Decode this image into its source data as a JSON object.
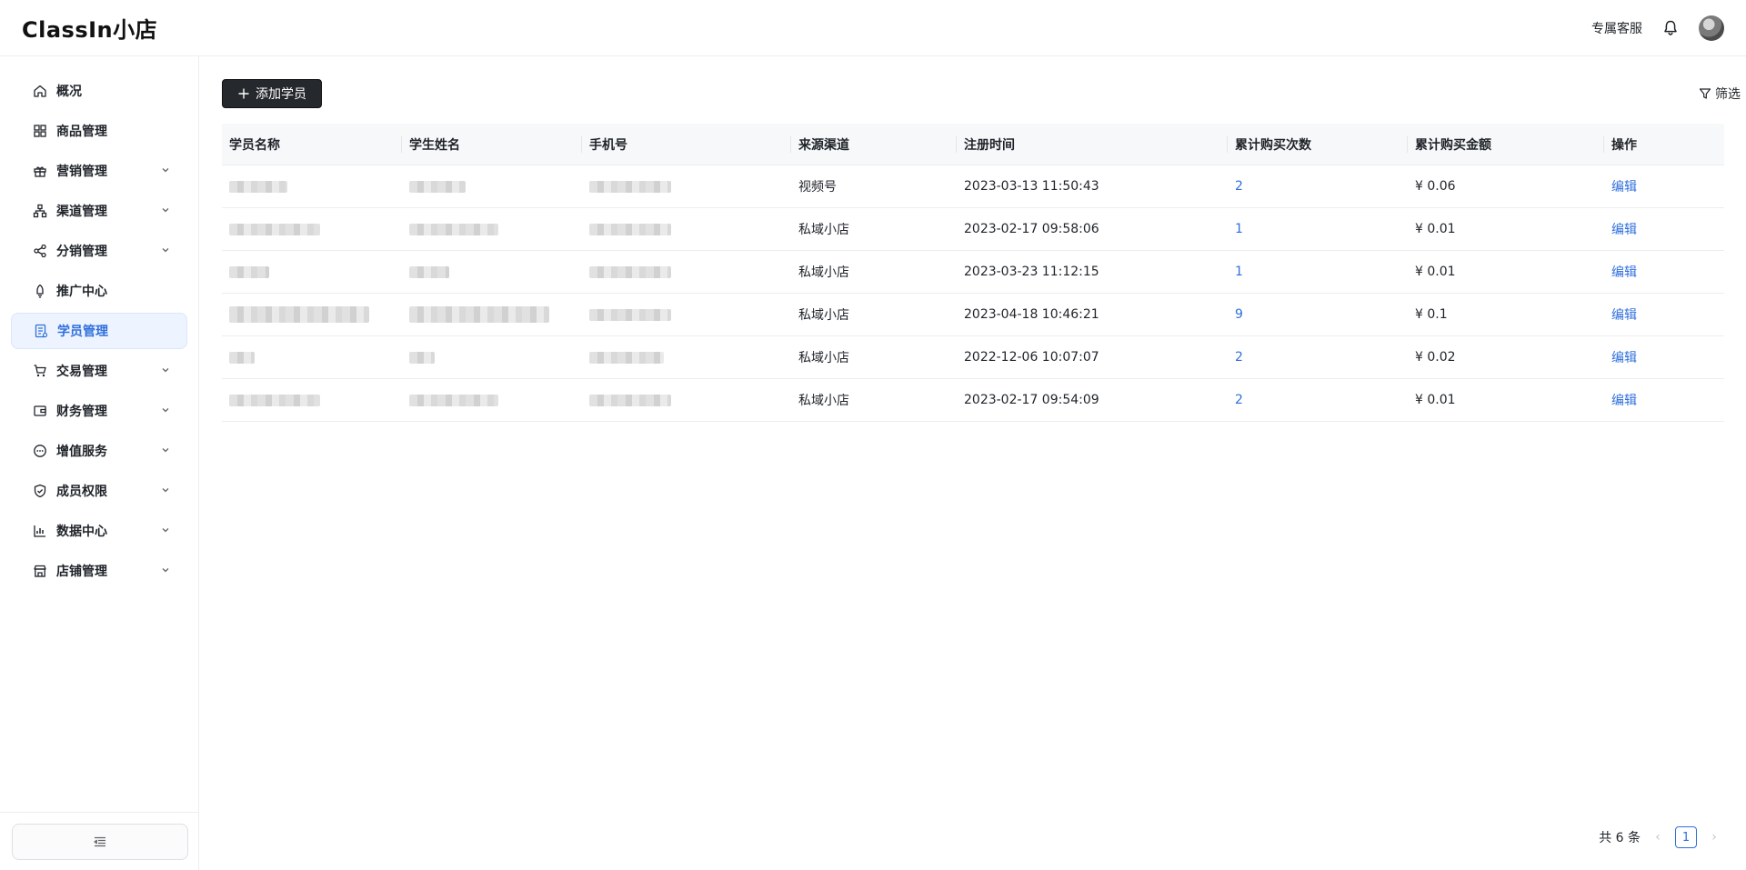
{
  "header": {
    "logo": "ClassIn小店",
    "service_link": "专属客服"
  },
  "sidebar": {
    "items": [
      {
        "label": "概况",
        "icon": "home-icon",
        "expandable": false
      },
      {
        "label": "商品管理",
        "icon": "grid-icon",
        "expandable": false
      },
      {
        "label": "营销管理",
        "icon": "gift-icon",
        "expandable": true
      },
      {
        "label": "渠道管理",
        "icon": "hierarchy-icon",
        "expandable": true
      },
      {
        "label": "分销管理",
        "icon": "share-icon",
        "expandable": true
      },
      {
        "label": "推广中心",
        "icon": "rocket-icon",
        "expandable": false
      },
      {
        "label": "学员管理",
        "icon": "student-icon",
        "expandable": false,
        "active": true
      },
      {
        "label": "交易管理",
        "icon": "cart-icon",
        "expandable": true
      },
      {
        "label": "财务管理",
        "icon": "wallet-icon",
        "expandable": true
      },
      {
        "label": "增值服务",
        "icon": "chat-icon",
        "expandable": true
      },
      {
        "label": "成员权限",
        "icon": "shield-icon",
        "expandable": true
      },
      {
        "label": "数据中心",
        "icon": "chart-icon",
        "expandable": true
      },
      {
        "label": "店铺管理",
        "icon": "store-icon",
        "expandable": true
      }
    ]
  },
  "toolbar": {
    "add_label": "添加学员",
    "filter_label": "筛选"
  },
  "table": {
    "columns": [
      "学员名称",
      "学生姓名",
      "手机号",
      "来源渠道",
      "注册时间",
      "累计购买次数",
      "累计购买金额",
      "操作"
    ],
    "rows": [
      {
        "channel": "视频号",
        "time": "2023-03-13 11:50:43",
        "count": "2",
        "amount": "¥ 0.06",
        "action": "编辑"
      },
      {
        "channel": "私域小店",
        "time": "2023-02-17 09:58:06",
        "count": "1",
        "amount": "¥ 0.01",
        "action": "编辑"
      },
      {
        "channel": "私域小店",
        "time": "2023-03-23 11:12:15",
        "count": "1",
        "amount": "¥ 0.01",
        "action": "编辑"
      },
      {
        "channel": "私域小店",
        "time": "2023-04-18 10:46:21",
        "count": "9",
        "amount": "¥ 0.1",
        "action": "编辑"
      },
      {
        "channel": "私域小店",
        "time": "2022-12-06 10:07:07",
        "count": "2",
        "amount": "¥ 0.02",
        "action": "编辑"
      },
      {
        "channel": "私域小店",
        "time": "2023-02-17 09:54:09",
        "count": "2",
        "amount": "¥ 0.01",
        "action": "编辑"
      }
    ]
  },
  "pagination": {
    "total_text": "共 6 条",
    "current_page": "1"
  }
}
